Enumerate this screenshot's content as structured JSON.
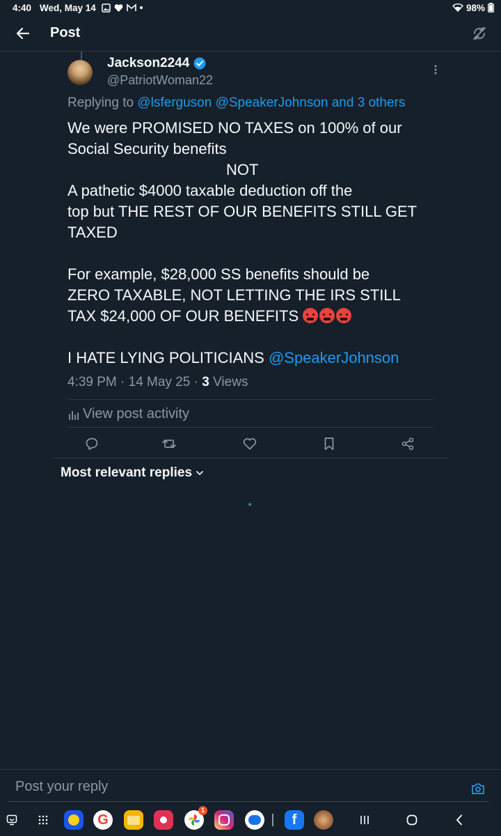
{
  "status_bar": {
    "time": "4:40",
    "date": "Wed, May 14",
    "battery": "98%"
  },
  "header": {
    "title": "Post"
  },
  "post": {
    "display_name": "Jackson2244",
    "handle": "@PatriotWoman22",
    "replying_prefix": "Replying to",
    "replying_to": "@lsferguson @SpeakerJohnson and 3 others",
    "lines": [
      "We were PROMISED NO TAXES on 100% of our",
      "Social Security benefits",
      "NOT",
      "A pathetic $4000 taxable deduction off the",
      "top but THE REST OF OUR BENEFITS STILL GET",
      "TAXED",
      "",
      "For example, $28,000 SS benefits should be",
      "ZERO TAXABLE,  NOT LETTING THE IRS STILL",
      "TAX $24,000 OF OUR BENEFITS",
      "",
      "I HATE LYING POLITICIANS"
    ],
    "mention_end": "@SpeakerJohnson",
    "emoji_count": 3,
    "timestamp": "4:39 PM · 14 May 25 · ",
    "views_count": "3",
    "views_label": " Views",
    "activity_label": "View post activity"
  },
  "replies": {
    "sort_label": "Most relevant replies"
  },
  "reply_box": {
    "placeholder": "Post your reply"
  },
  "colors": {
    "background": "#15202b",
    "accent": "#1d9bf0",
    "muted": "#8b98a5"
  },
  "icons": {
    "actions": [
      "reply-icon",
      "repost-icon",
      "like-icon",
      "bookmark-icon",
      "share-icon"
    ],
    "apps": [
      "bixby-app",
      "google-app",
      "files-app",
      "screen-recorder-app",
      "photos-app",
      "instagram-app",
      "messages-app",
      "facebook-app",
      "game-app"
    ],
    "photos_badge": "1"
  }
}
